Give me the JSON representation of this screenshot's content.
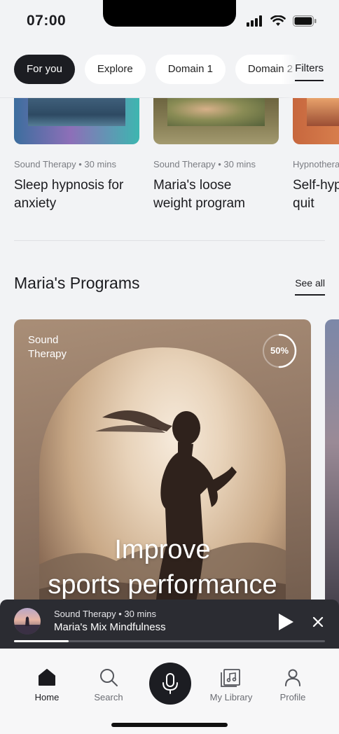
{
  "status_bar": {
    "time": "07:00"
  },
  "chips": [
    {
      "label": "For you",
      "active": true
    },
    {
      "label": "Explore",
      "active": false
    },
    {
      "label": "Domain 1",
      "active": false
    },
    {
      "label": "Domain 2",
      "active": false
    }
  ],
  "filters_label": "Filters",
  "recent_cards": [
    {
      "meta": "Sound Therapy • 30 mins",
      "title": "Sleep hypnosis for anxiety"
    },
    {
      "meta": "Sound Therapy • 30 mins",
      "title": "Maria's loose weight program"
    },
    {
      "meta": "Hypnotherapy",
      "title": "Self-hypnosis for quit"
    }
  ],
  "section": {
    "title": "Maria's Programs",
    "see_all": "See all"
  },
  "program_card": {
    "category": "Sound Therapy",
    "progress_label": "50%",
    "progress_fraction": 0.5,
    "title_line1": "Improve",
    "title_line2": "sports performance"
  },
  "mini_player": {
    "meta": "Sound Therapy • 30 mins",
    "title": "Maria's Mix Mindfulness",
    "progress_fraction": 0.175
  },
  "tab_bar": {
    "home": "Home",
    "search": "Search",
    "library": "My Library",
    "profile": "Profile"
  },
  "colors": {
    "accent_dark": "#1c1d22",
    "background": "#f2f3f5",
    "player": "#2b2c32"
  }
}
